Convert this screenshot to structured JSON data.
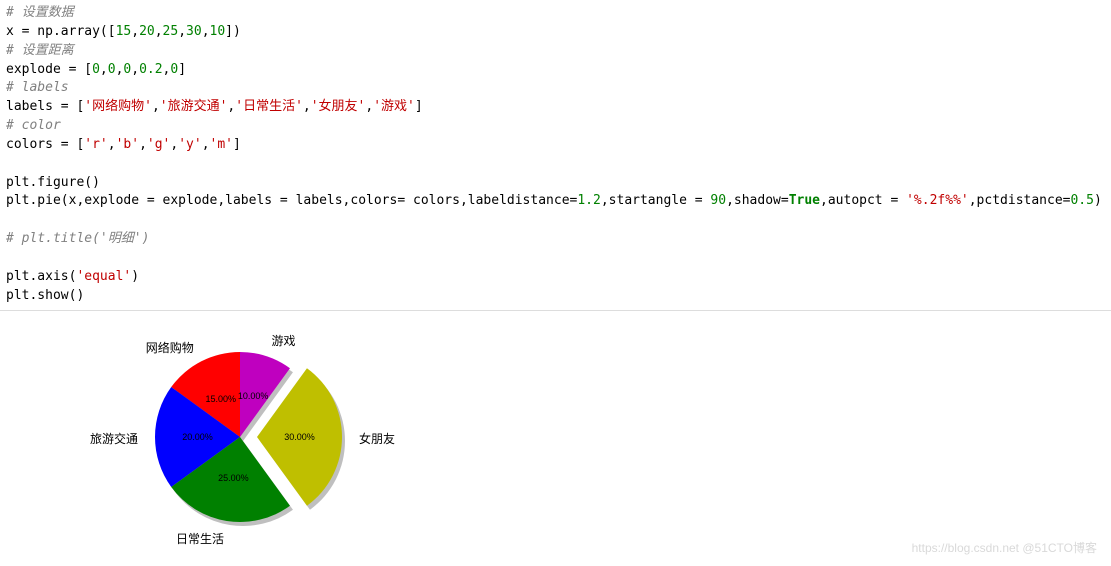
{
  "code": {
    "c1": "# 设置数据",
    "l2a": "x = np.array([",
    "l2n1": "15",
    "l2s1": ",",
    "l2n2": "20",
    "l2s2": ",",
    "l2n3": "25",
    "l2s3": ",",
    "l2n4": "30",
    "l2s4": ",",
    "l2n5": "10",
    "l2b": "])",
    "c3": "# 设置距离",
    "l4a": "explode = [",
    "l4n1": "0",
    "l4s1": ",",
    "l4n2": "0",
    "l4s2": ",",
    "l4n3": "0",
    "l4s3": ",",
    "l4n4": "0.2",
    "l4s4": ",",
    "l4n5": "0",
    "l4b": "]",
    "c5": "# labels",
    "l6a": "labels = [",
    "l6s1": "'网络购物'",
    "l6c1": ",",
    "l6s2": "'旅游交通'",
    "l6c2": ",",
    "l6s3": "'日常生活'",
    "l6c3": ",",
    "l6s4": "'女朋友'",
    "l6c4": ",",
    "l6s5": "'游戏'",
    "l6b": "]",
    "c7": "# color",
    "l8a": "colors = [",
    "l8s1": "'r'",
    "l8c1": ",",
    "l8s2": "'b'",
    "l8c2": ",",
    "l8s3": "'g'",
    "l8c3": ",",
    "l8s4": "'y'",
    "l8c4": ",",
    "l8s5": "'m'",
    "l8b": "]",
    "l10": "plt.figure()",
    "l11a": "plt.pie(x,explode = explode,labels = labels,colors= colors,labeldistance=",
    "l11n1": "1.2",
    "l11b": ",startangle = ",
    "l11n2": "90",
    "l11c": ",shadow=",
    "l11kw": "True",
    "l11d": ",autopct = ",
    "l11s": "'%.2f%%'",
    "l11e": ",pctdistance=",
    "l11n3": "0.5",
    "l11f": ")",
    "c13": "# plt.title('明细')",
    "l15a": "plt.axis(",
    "l15s": "'equal'",
    "l15b": ")",
    "l16": "plt.show()"
  },
  "chart_data": {
    "type": "pie",
    "title": "",
    "labels": [
      "网络购物",
      "旅游交通",
      "日常生活",
      "女朋友",
      "游戏"
    ],
    "values": [
      15,
      20,
      25,
      30,
      10
    ],
    "percent_labels": [
      "15.00%",
      "20.00%",
      "25.00%",
      "30.00%",
      "10.00%"
    ],
    "colors": [
      "#ff0000",
      "#0000ff",
      "#008000",
      "#bfbf00",
      "#bf00bf"
    ],
    "explode": [
      0,
      0,
      0,
      0.2,
      0
    ],
    "startangle": 90,
    "labeldistance": 1.2,
    "pctdistance": 0.5,
    "autopct": "%.2f%%",
    "shadow": true
  },
  "watermark": "https://blog.csdn.net  @51CTO博客"
}
